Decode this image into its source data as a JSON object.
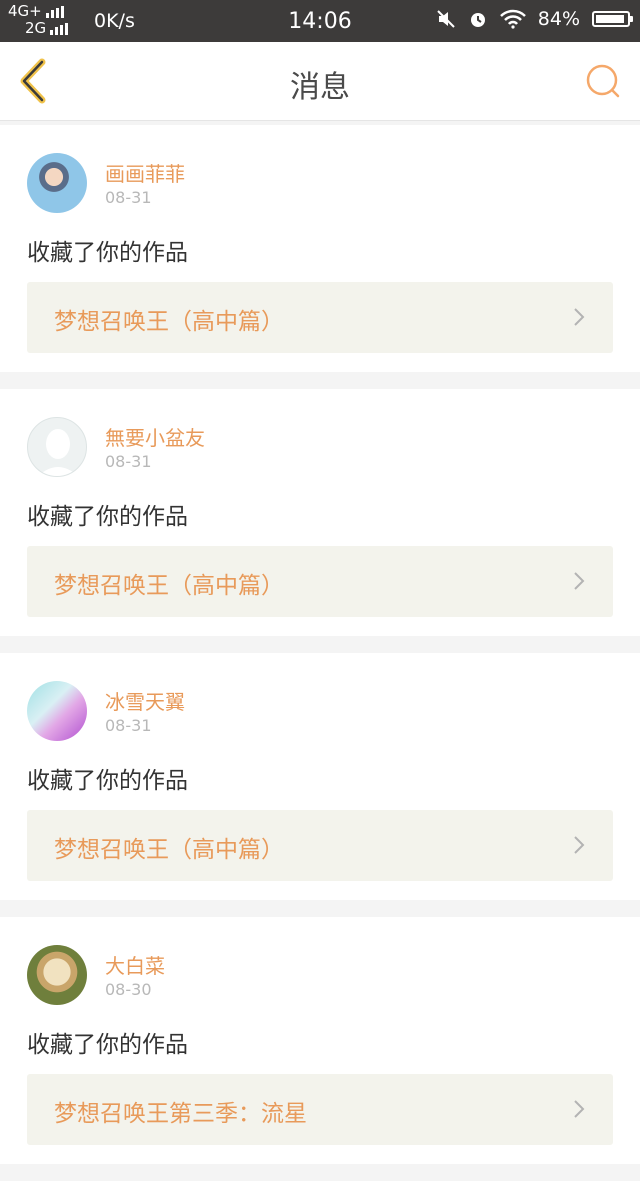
{
  "status_bar": {
    "network_top": "4G+",
    "network_bottom": "2G",
    "speed": "0K/s",
    "time": "14:06",
    "battery": "84%"
  },
  "nav": {
    "title": "消息",
    "accent_color": "#f5a86a"
  },
  "messages": [
    {
      "user": "画画菲菲",
      "date": "08-31",
      "action": "收藏了你的作品",
      "work": "梦想召唤王（高中篇）"
    },
    {
      "user": "無要小盆友",
      "date": "08-31",
      "action": "收藏了你的作品",
      "work": "梦想召唤王（高中篇）"
    },
    {
      "user": "冰雪天翼",
      "date": "08-31",
      "action": "收藏了你的作品",
      "work": "梦想召唤王（高中篇）"
    },
    {
      "user": "大白菜",
      "date": "08-30",
      "action": "收藏了你的作品",
      "work": "梦想召唤王第三季：流星"
    }
  ]
}
